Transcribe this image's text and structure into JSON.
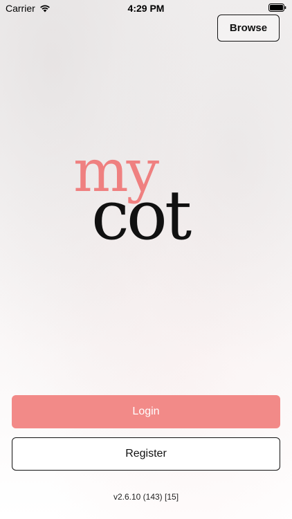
{
  "status_bar": {
    "carrier": "Carrier",
    "time": "4:29 PM",
    "wifi_icon": "wifi-icon",
    "battery_icon": "battery-icon"
  },
  "header": {
    "browse_label": "Browse"
  },
  "logo": {
    "line1": "my",
    "line2": "cot",
    "colors": {
      "my": "#ef8080",
      "cot": "#111111"
    }
  },
  "actions": {
    "login_label": "Login",
    "register_label": "Register"
  },
  "footer": {
    "version": "v2.6.10 (143) [15]"
  },
  "theme": {
    "accent": "#f28a88",
    "text": "#111111",
    "background": "#f3f1f1"
  }
}
